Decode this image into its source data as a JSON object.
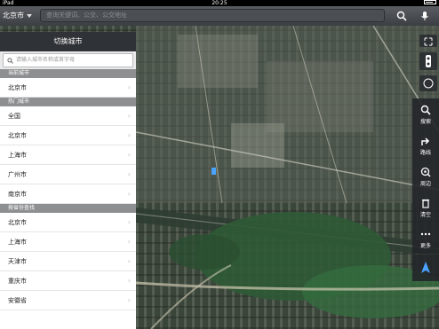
{
  "status_bar": {
    "carrier": "iPad",
    "time": "20:25"
  },
  "top_bar": {
    "city": "北京市",
    "search_placeholder": "查询关键词、公交、公交地址"
  },
  "panel": {
    "title": "切换城市",
    "search_placeholder": "请输入城市名称或首字母",
    "current_header": "当前城市",
    "current_city": "北京市",
    "hot_header": "热门城市",
    "hot_cities": [
      "全国",
      "北京市",
      "上海市",
      "广州市",
      "南京市"
    ],
    "province_header": "按省份查找",
    "provinces": [
      "北京市",
      "上海市",
      "天津市",
      "重庆市",
      "安徽省"
    ]
  },
  "toolbar": {
    "search": "搜索",
    "route": "路线",
    "nearby": "周边",
    "clear": "清空",
    "more": "更多"
  },
  "colors": {
    "toolbar_bg": "#23262a",
    "nav_arrow": "#4aa3ff",
    "panel_header": "#2f3236"
  }
}
